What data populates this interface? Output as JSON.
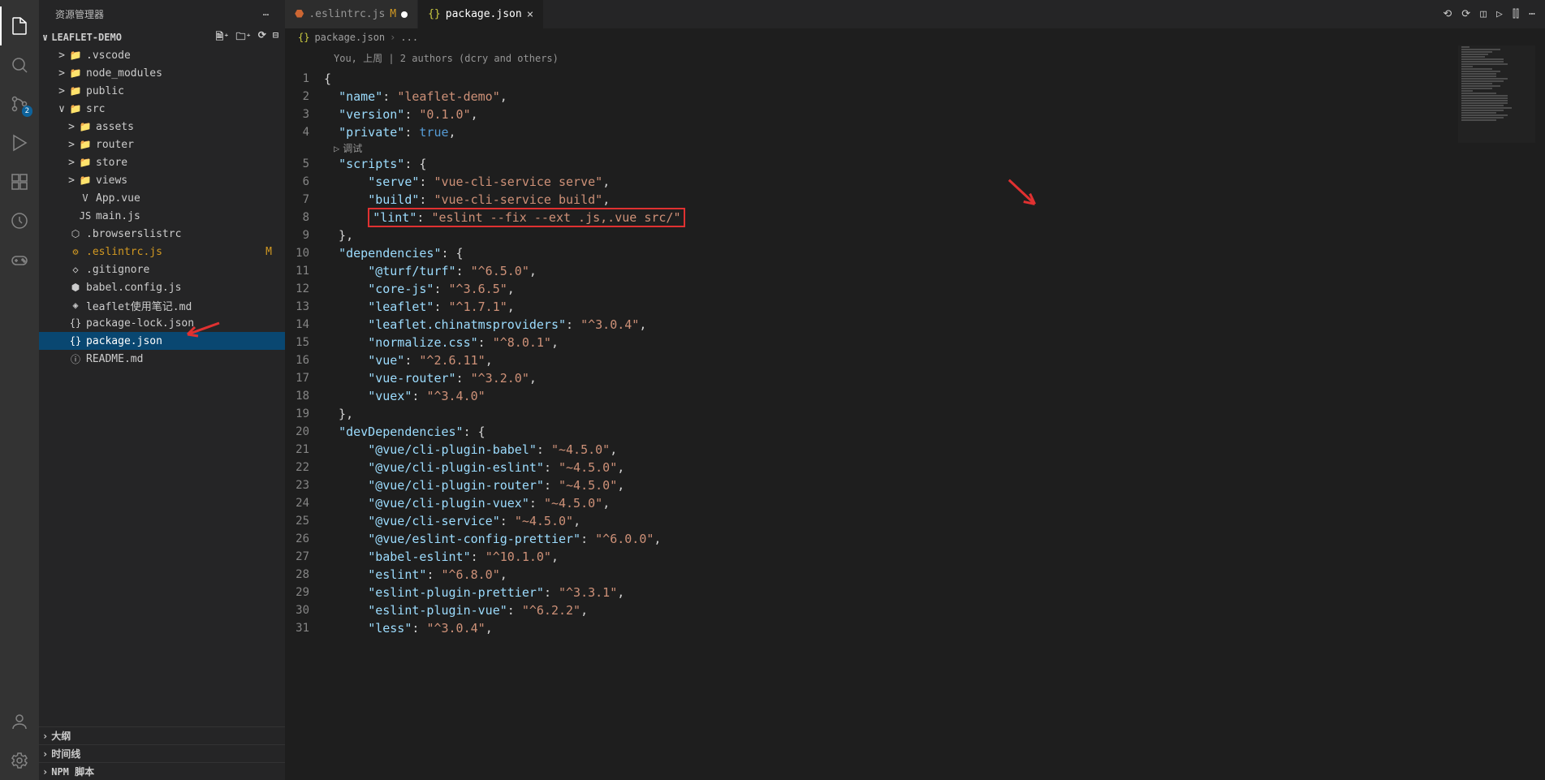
{
  "sidebarTitle": "资源管理器",
  "projectName": "LEAFLET-DEMO",
  "scmBadge": "2",
  "tree": [
    {
      "depth": 1,
      "tw": ">",
      "icon": "📁",
      "label": ".vscode",
      "cls": ""
    },
    {
      "depth": 1,
      "tw": ">",
      "icon": "📁",
      "label": "node_modules",
      "cls": ""
    },
    {
      "depth": 1,
      "tw": ">",
      "icon": "📁",
      "label": "public",
      "cls": ""
    },
    {
      "depth": 1,
      "tw": "∨",
      "icon": "📁",
      "label": "src",
      "cls": ""
    },
    {
      "depth": 2,
      "tw": ">",
      "icon": "📁",
      "label": "assets",
      "cls": ""
    },
    {
      "depth": 2,
      "tw": ">",
      "icon": "📁",
      "label": "router",
      "cls": ""
    },
    {
      "depth": 2,
      "tw": ">",
      "icon": "📁",
      "label": "store",
      "cls": ""
    },
    {
      "depth": 2,
      "tw": ">",
      "icon": "📁",
      "label": "views",
      "cls": ""
    },
    {
      "depth": 2,
      "tw": "",
      "icon": "V",
      "label": "App.vue",
      "cls": ""
    },
    {
      "depth": 2,
      "tw": "",
      "icon": "JS",
      "label": "main.js",
      "cls": ""
    },
    {
      "depth": 1,
      "tw": "",
      "icon": "⬡",
      "label": ".browserslistrc",
      "cls": ""
    },
    {
      "depth": 1,
      "tw": "",
      "icon": "⚙",
      "label": ".eslintrc.js",
      "cls": "modified",
      "status": "M"
    },
    {
      "depth": 1,
      "tw": "",
      "icon": "◇",
      "label": ".gitignore",
      "cls": ""
    },
    {
      "depth": 1,
      "tw": "",
      "icon": "⬢",
      "label": "babel.config.js",
      "cls": ""
    },
    {
      "depth": 1,
      "tw": "",
      "icon": "◈",
      "label": "leaflet使用笔记.md",
      "cls": ""
    },
    {
      "depth": 1,
      "tw": "",
      "icon": "{}",
      "label": "package-lock.json",
      "cls": ""
    },
    {
      "depth": 1,
      "tw": "",
      "icon": "{}",
      "label": "package.json",
      "cls": "selected"
    },
    {
      "depth": 1,
      "tw": "",
      "icon": "ⓘ",
      "label": "README.md",
      "cls": ""
    }
  ],
  "bottomSections": [
    "大纲",
    "时间线",
    "NPM 脚本"
  ],
  "tab1": ".eslintrc.js",
  "tab1Status": "M",
  "tab2": "package.json",
  "breadcrumb": "package.json",
  "breadcrumbRest": "...",
  "codelens": "You, 上周 | 2 authors (dcry and others)",
  "debugLabel": "调试",
  "codeLines": [
    {
      "n": "1",
      "txt": "{",
      "type": "punc"
    },
    {
      "n": "2",
      "prop": "\"name\"",
      "val": "\"leaflet-demo\"",
      "trail": ","
    },
    {
      "n": "3",
      "prop": "\"version\"",
      "val": "\"0.1.0\"",
      "trail": ","
    },
    {
      "n": "4",
      "prop": "\"private\"",
      "kw": "true",
      "trail": ","
    },
    {
      "n": "5",
      "prop": "\"scripts\"",
      "open": "{"
    },
    {
      "n": "6",
      "prop": "\"serve\"",
      "val": "\"vue-cli-service serve\"",
      "trail": ",",
      "indent": 1
    },
    {
      "n": "7",
      "prop": "\"build\"",
      "val": "\"vue-cli-service build\"",
      "trail": ",",
      "indent": 1
    },
    {
      "n": "8",
      "prop": "\"lint\"",
      "val": "\"eslint --fix --ext .js,.vue src/\"",
      "indent": 1,
      "boxed": true
    },
    {
      "n": "9",
      "txt": "},",
      "type": "punc",
      "indent": 0,
      "close": true
    },
    {
      "n": "10",
      "prop": "\"dependencies\"",
      "open": "{"
    },
    {
      "n": "11",
      "prop": "\"@turf/turf\"",
      "val": "\"^6.5.0\"",
      "trail": ",",
      "indent": 1
    },
    {
      "n": "12",
      "prop": "\"core-js\"",
      "val": "\"^3.6.5\"",
      "trail": ",",
      "indent": 1
    },
    {
      "n": "13",
      "prop": "\"leaflet\"",
      "val": "\"^1.7.1\"",
      "trail": ",",
      "indent": 1
    },
    {
      "n": "14",
      "prop": "\"leaflet.chinatmsproviders\"",
      "val": "\"^3.0.4\"",
      "trail": ",",
      "indent": 1
    },
    {
      "n": "15",
      "prop": "\"normalize.css\"",
      "val": "\"^8.0.1\"",
      "trail": ",",
      "indent": 1
    },
    {
      "n": "16",
      "prop": "\"vue\"",
      "val": "\"^2.6.11\"",
      "trail": ",",
      "indent": 1
    },
    {
      "n": "17",
      "prop": "\"vue-router\"",
      "val": "\"^3.2.0\"",
      "trail": ",",
      "indent": 1
    },
    {
      "n": "18",
      "prop": "\"vuex\"",
      "val": "\"^3.4.0\"",
      "indent": 1
    },
    {
      "n": "19",
      "txt": "},",
      "type": "punc",
      "close": true
    },
    {
      "n": "20",
      "prop": "\"devDependencies\"",
      "open": "{"
    },
    {
      "n": "21",
      "prop": "\"@vue/cli-plugin-babel\"",
      "val": "\"~4.5.0\"",
      "trail": ",",
      "indent": 1
    },
    {
      "n": "22",
      "prop": "\"@vue/cli-plugin-eslint\"",
      "val": "\"~4.5.0\"",
      "trail": ",",
      "indent": 1
    },
    {
      "n": "23",
      "prop": "\"@vue/cli-plugin-router\"",
      "val": "\"~4.5.0\"",
      "trail": ",",
      "indent": 1
    },
    {
      "n": "24",
      "prop": "\"@vue/cli-plugin-vuex\"",
      "val": "\"~4.5.0\"",
      "trail": ",",
      "indent": 1
    },
    {
      "n": "25",
      "prop": "\"@vue/cli-service\"",
      "val": "\"~4.5.0\"",
      "trail": ",",
      "indent": 1
    },
    {
      "n": "26",
      "prop": "\"@vue/eslint-config-prettier\"",
      "val": "\"^6.0.0\"",
      "trail": ",",
      "indent": 1
    },
    {
      "n": "27",
      "prop": "\"babel-eslint\"",
      "val": "\"^10.1.0\"",
      "trail": ",",
      "indent": 1
    },
    {
      "n": "28",
      "prop": "\"eslint\"",
      "val": "\"^6.8.0\"",
      "trail": ",",
      "indent": 1
    },
    {
      "n": "29",
      "prop": "\"eslint-plugin-prettier\"",
      "val": "\"^3.3.1\"",
      "trail": ",",
      "indent": 1
    },
    {
      "n": "30",
      "prop": "\"eslint-plugin-vue\"",
      "val": "\"^6.2.2\"",
      "trail": ",",
      "indent": 1
    },
    {
      "n": "31",
      "prop": "\"less\"",
      "val": "\"^3.0.4\"",
      "trail": ",",
      "indent": 1
    }
  ]
}
